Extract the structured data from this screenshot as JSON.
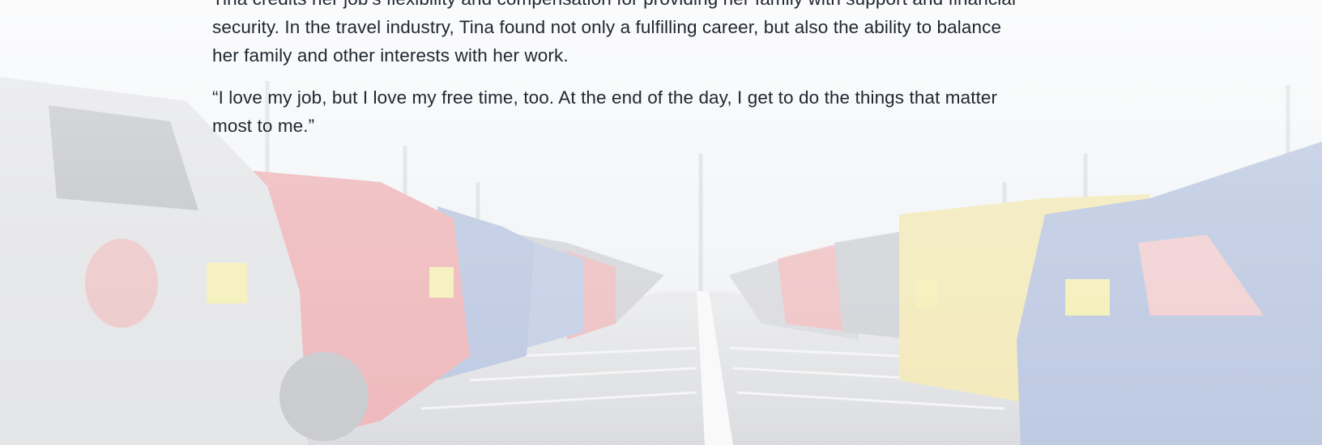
{
  "article": {
    "paragraph_1": "Tina credits her job’s flexibility and compensation for providing her family with support and financial security. In the travel industry, Tina found not only a fulfilling career, but also the ability to balance her family and other interests with her work.",
    "paragraph_2": "“I love my job, but I love my free time, too. At the end of the day, I get to do the things that matter most to me.”"
  },
  "background": {
    "scene": "parking-lot-cars-photo",
    "colors": {
      "sky": "#eef1f5",
      "red_car": "#e9a2a6",
      "blue_car": "#a9b9d9",
      "yellow_car": "#efe3a6",
      "silver_car": "#dcdde0",
      "asphalt": "#d7d8dc"
    }
  }
}
